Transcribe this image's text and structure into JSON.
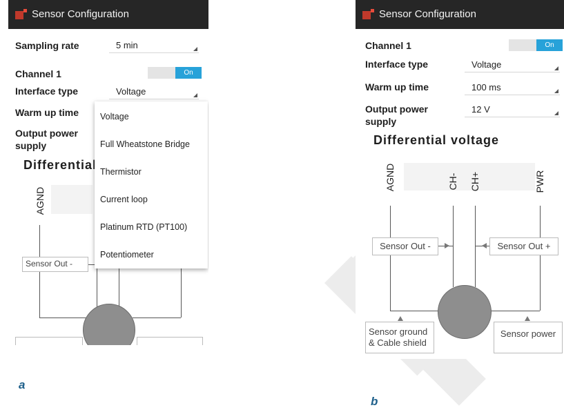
{
  "app_title": "Sensor Configuration",
  "accent_color": "#27a2d9",
  "panel_a": {
    "sampling_rate": {
      "label": "Sampling rate",
      "value": "5 min"
    },
    "channel": {
      "label": "Channel 1",
      "toggle": "On"
    },
    "interface_type": {
      "label": "Interface type",
      "value": "Voltage"
    },
    "warm_up_time": {
      "label": "Warm up time"
    },
    "output_power_supply": {
      "label_line1": "Output power",
      "label_line2": "supply"
    },
    "diagram_title": "Differential",
    "pin_label": "AGND",
    "sensor_out_minus": "Sensor Out -",
    "dropdown_options": [
      "Voltage",
      "Full Wheatstone Bridge",
      "Thermistor",
      "Current loop",
      "Platinum RTD (PT100)",
      "Potentiometer"
    ],
    "caption": "a"
  },
  "panel_b": {
    "channel": {
      "label": "Channel 1",
      "toggle": "On"
    },
    "interface_type": {
      "label": "Interface type",
      "value": "Voltage"
    },
    "warm_up_time": {
      "label": "Warm up time",
      "value": "100 ms"
    },
    "output_power_supply": {
      "label_line1": "Output power",
      "label_line2": "supply",
      "value": "12 V"
    },
    "diagram_title": "Differential voltage",
    "pins": [
      "AGND",
      "CH-",
      "CH+",
      "PWR"
    ],
    "sensor_out_minus": "Sensor Out -",
    "sensor_out_plus": "Sensor Out +",
    "sensor_ground_line1": "Sensor ground",
    "sensor_ground_line2": "& Cable shield",
    "sensor_power": "Sensor power",
    "caption": "b"
  }
}
